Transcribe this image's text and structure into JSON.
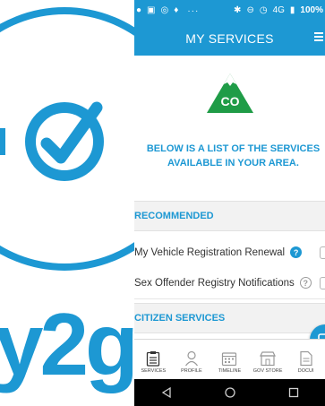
{
  "colors": {
    "brand_blue": "#1d98d3",
    "co_green": "#1f9c47",
    "dark_green": "#0d6b34"
  },
  "brand": {
    "text": "y2go",
    "logo_icon": "checkmark-circle-icon"
  },
  "status_bar": {
    "left_icons": [
      "notification-icon",
      "linkedin-icon",
      "instagram-icon",
      "twitter-icon"
    ],
    "dots": "···",
    "right_icons": [
      "bluetooth-icon",
      "minus-circle-icon",
      "alarm-icon",
      "signal-icon"
    ],
    "network": "4G",
    "battery": "100%"
  },
  "header": {
    "title": "MY SERVICES",
    "menu_icon": "hamburger-menu-icon"
  },
  "intro": {
    "line1": "BELOW IS A LIST OF THE SERVICES",
    "line2": "AVAILABLE IN YOUR AREA.",
    "logo_text": "CO"
  },
  "sections": {
    "recommended": "RECOMMENDED",
    "citizen": "CITIZEN SERVICES"
  },
  "services": [
    {
      "label": "My Vehicle Registration Renewal",
      "help": "?"
    },
    {
      "label": "Sex Offender Registry Notifications",
      "help": "?"
    }
  ],
  "bottom_nav": [
    {
      "label": "SERVICES",
      "icon": "clipboard-icon"
    },
    {
      "label": "PROFILE",
      "icon": "person-icon"
    },
    {
      "label": "TIMELINE",
      "icon": "calendar-icon"
    },
    {
      "label": "GOV STORE",
      "icon": "storefront-icon"
    },
    {
      "label": "DOCUI",
      "icon": "document-icon"
    }
  ],
  "system_nav": [
    "back-icon",
    "home-icon",
    "recents-icon"
  ]
}
